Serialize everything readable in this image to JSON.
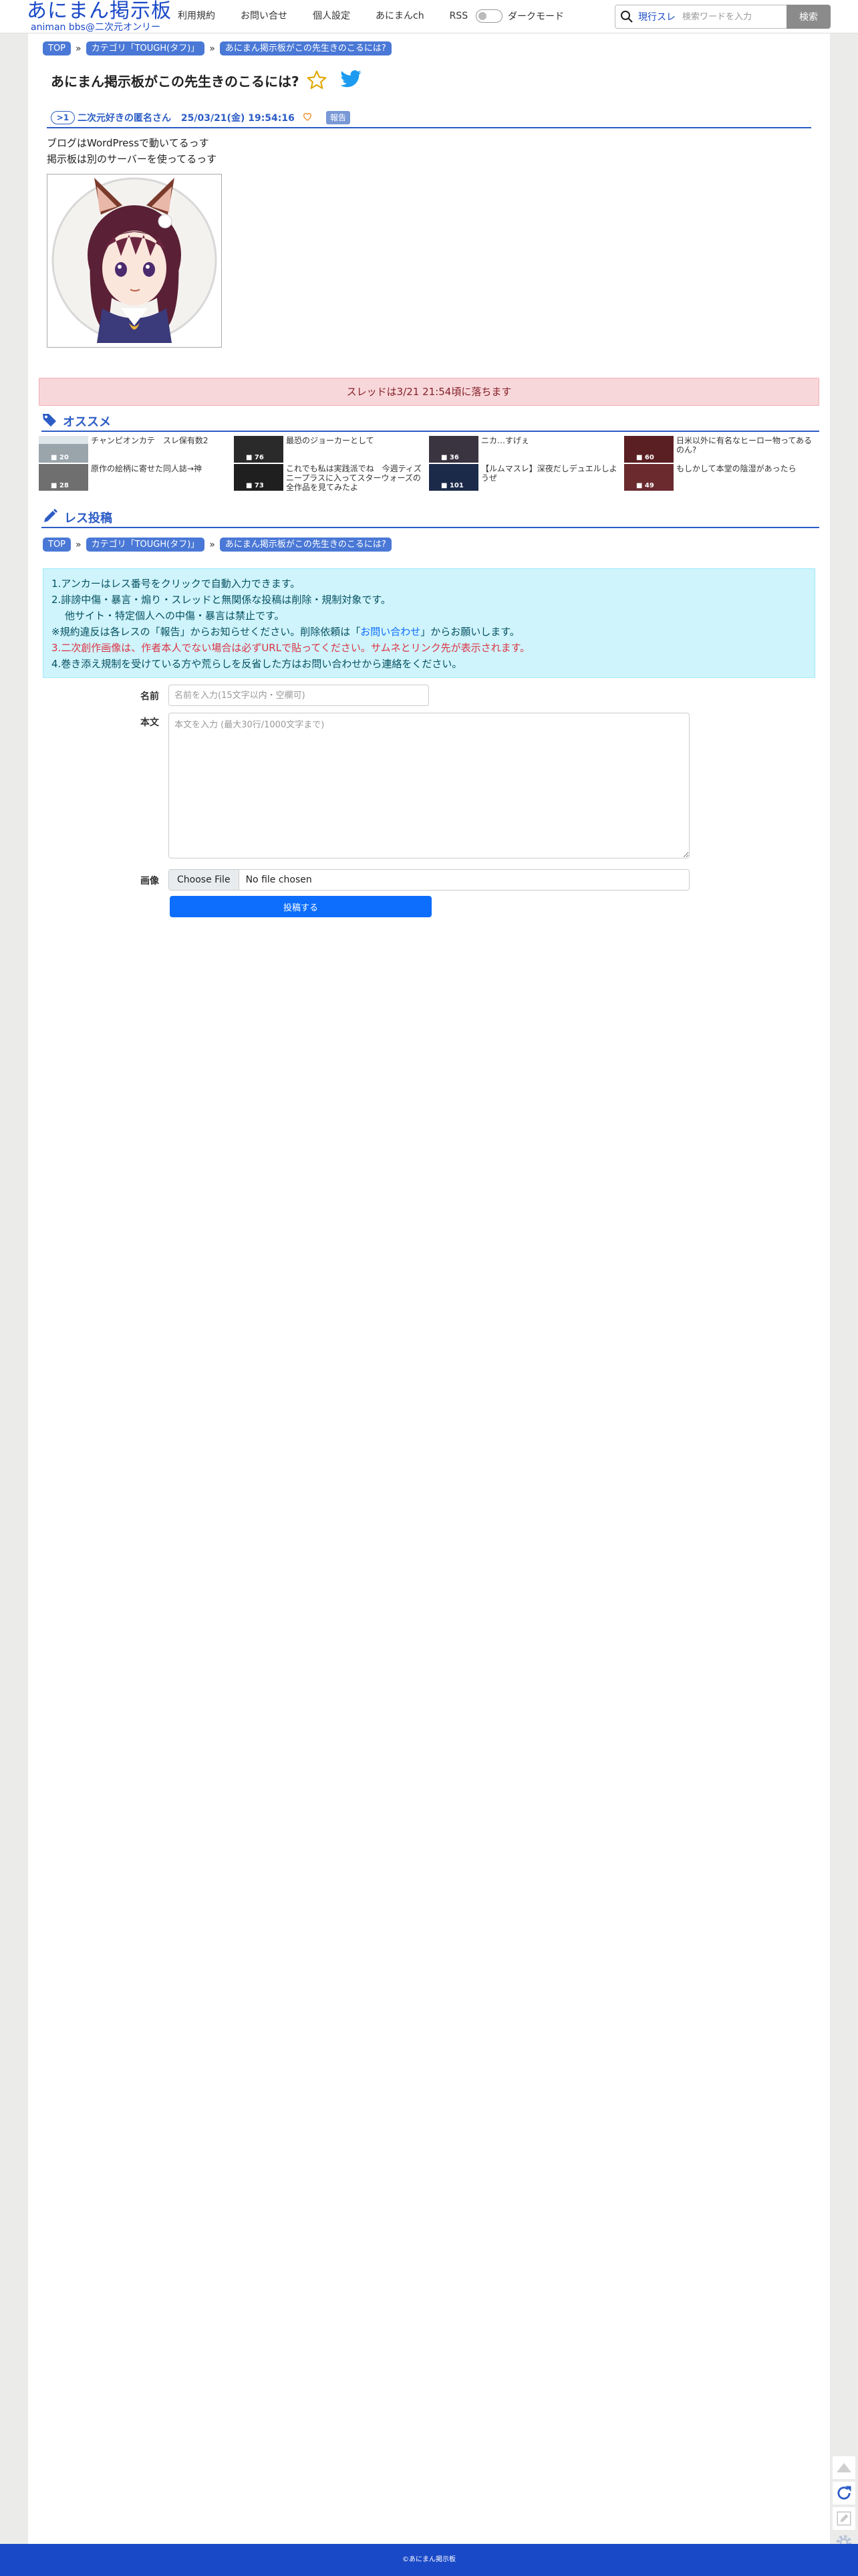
{
  "header": {
    "logo_title": "あにまん掲示板",
    "logo_sub": "animan bbs@二次元オンリー",
    "nav": [
      "利用規約",
      "お問い合せ",
      "個人設定",
      "あにまんch",
      "RSS"
    ],
    "dark_mode_label": "ダークモード",
    "search_scope": "現行スレ",
    "search_placeholder": "検索ワードを入力",
    "search_button": "検索"
  },
  "breadcrumb": {
    "top": "TOP",
    "category": "カテゴリ「TOUGH(タフ)」",
    "current": "あにまん掲示板がこの先生きのこるには?"
  },
  "thread": {
    "title": "あにまん掲示板がこの先生きのこるには?",
    "post": {
      "number": ">1",
      "author": "二次元好きの匿名さん",
      "date": "25/03/21(金) 19:54:16",
      "report_label": "報告",
      "lines": [
        "ブログはWordPressで動いてるっす",
        "掲示板は別のサーバーを使ってるっす"
      ]
    },
    "closed_notice": "スレッドは3/21 21:54頃に落ちます"
  },
  "recommend": {
    "title": "オススメ",
    "items": [
      {
        "text": "チャンピオンカテ　スレ保有数2",
        "count": "20"
      },
      {
        "text": "最恐のジョーカーとして",
        "count": "76"
      },
      {
        "text": "ニカ…すげぇ",
        "count": "36"
      },
      {
        "text": "日米以外に有名なヒーロー物ってあるのん?",
        "count": "60"
      },
      {
        "text": "原作の絵柄に寄せた同人誌→神",
        "count": "28"
      },
      {
        "text": "これでも私は実践派でね　今週ティズニープラスに入ってスターウォーズの全作品を見てみたよ",
        "count": "73"
      },
      {
        "text": "【ルムマスレ】深夜だしデュエルしようぜ",
        "count": "101"
      },
      {
        "text": "もしかして本堂の陰湿があったら",
        "count": "49"
      }
    ]
  },
  "reply": {
    "title": "レス投稿",
    "rules": {
      "line1": "1.アンカーはレス番号をクリックで自動入力できます。",
      "line2": "2.誹謗中傷・暴言・煽り・スレッドと無関係な投稿は削除・規制対象です。",
      "line2b": "他サイト・特定個人への中傷・暴言は禁止です。",
      "line3_pre": "※規約違反は各レスの「報告」からお知らせください。削除依頼は「",
      "line3_link": "お問い合わせ",
      "line3_post": "」からお願いします。",
      "line4": "3.二次創作画像は、作者本人でない場合は必ずURLで貼ってください。サムネとリンク先が表示されます。",
      "line5": "4.巻き添え規制を受けている方や荒らしを反省した方はお問い合わせから連絡をください。"
    },
    "name_label": "名前",
    "name_placeholder": "名前を入力(15文字以内・空欄可)",
    "body_label": "本文",
    "body_placeholder": "本文を入力 (最大30行/1000文字まで)",
    "image_label": "画像",
    "file_button": "Choose File",
    "file_status": "No file chosen",
    "submit": "投稿する"
  },
  "footer": {
    "copyright": "©あにまん掲示板"
  },
  "colors": {
    "brand": "#1a49c8",
    "accent": "#2c5cc5",
    "alert_bg": "#f8d7da",
    "info_bg": "#cff4fc"
  }
}
